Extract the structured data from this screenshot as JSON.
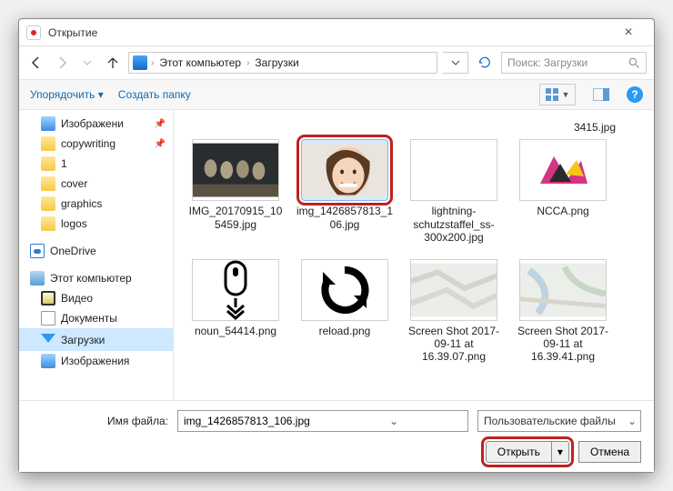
{
  "title": "Открытие",
  "breadcrumb": {
    "root": "Этот компьютер",
    "folder": "Загрузки"
  },
  "search": {
    "placeholder": "Поиск: Загрузки"
  },
  "toolbar": {
    "organize": "Упорядочить",
    "newfolder": "Создать папку",
    "help": "?"
  },
  "tree": {
    "images": "Изображени",
    "copywriting": "copywriting",
    "one": "1",
    "cover": "cover",
    "graphics": "graphics",
    "logos": "logos",
    "onedrive": "OneDrive",
    "thispc": "Этот компьютер",
    "video": "Видео",
    "documents": "Документы",
    "downloads": "Загрузки",
    "images2": "Изображения"
  },
  "files": {
    "truncated": "3415.jpg",
    "f0": "IMG_20170915_105459.jpg",
    "f1": "img_1426857813_106.jpg",
    "f2": "lightning-schutzstaffel_ss-300x200.jpg",
    "f3": "NCCA.png",
    "f4": "noun_54414.png",
    "f5": "reload.png",
    "f6": "Screen Shot 2017-09-11 at 16.39.07.png",
    "f7": "Screen Shot 2017-09-11 at 16.39.41.png"
  },
  "footer": {
    "filename_label": "Имя файла:",
    "filename_value": "img_1426857813_106.jpg",
    "filter": "Пользовательские файлы",
    "open": "Открыть",
    "cancel": "Отмена"
  }
}
